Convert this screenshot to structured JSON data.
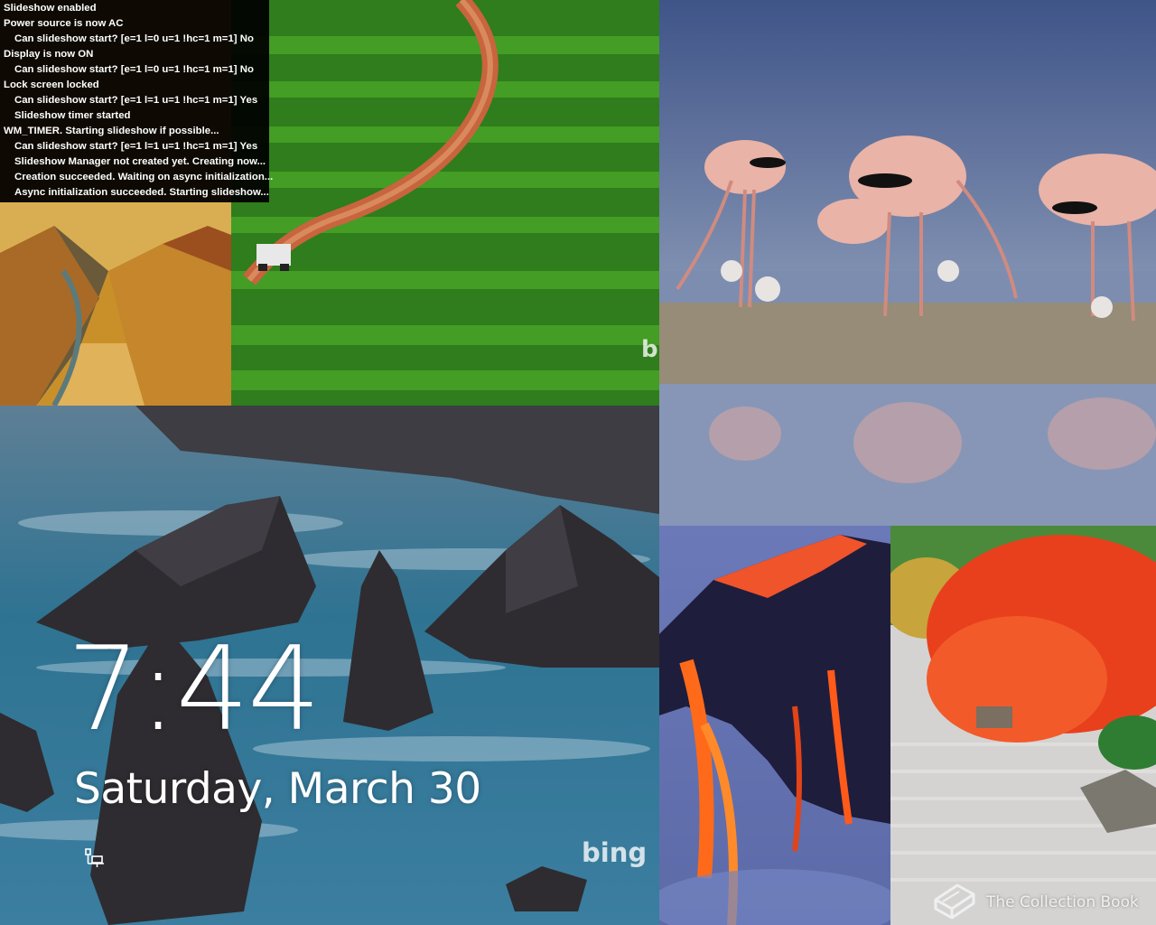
{
  "debug_log": [
    {
      "text": "Slideshow enabled",
      "indent": false
    },
    {
      "text": "Power source is now AC",
      "indent": false
    },
    {
      "text": "Can slideshow start? [e=1 l=0 u=1 !hc=1 m=1] No",
      "indent": true
    },
    {
      "text": "Display is now ON",
      "indent": false
    },
    {
      "text": "Can slideshow start? [e=1 l=0 u=1 !hc=1 m=1] No",
      "indent": true
    },
    {
      "text": "Lock screen locked",
      "indent": false
    },
    {
      "text": "Can slideshow start? [e=1 l=1 u=1 !hc=1 m=1] Yes",
      "indent": true
    },
    {
      "text": "Slideshow timer started",
      "indent": true
    },
    {
      "text": "WM_TIMER.  Starting slideshow if possible...",
      "indent": false
    },
    {
      "text": "Can slideshow start? [e=1 l=1 u=1 !hc=1 m=1] Yes",
      "indent": true
    },
    {
      "text": "Slideshow Manager not created yet.  Creating now...",
      "indent": true
    },
    {
      "text": "Creation succeeded.  Waiting on async initialization...",
      "indent": true
    },
    {
      "text": "Async initialization succeeded.  Starting slideshow...",
      "indent": true
    }
  ],
  "lock_screen": {
    "time": "7:44",
    "date": "Saturday, March 30"
  },
  "watermarks": {
    "bing_coast": "bing",
    "bing_tea": "b",
    "collection_label": "The Collection Book"
  },
  "icons": {
    "network": "network-status-icon",
    "book": "book-icon"
  },
  "colors": {
    "sea": "#2d6f8e",
    "tea_green": "#3f9a22",
    "flamingo_sky": "#465a8c",
    "lava": "#f2562a",
    "maple": "#e8401c",
    "text": "#ffffff"
  }
}
